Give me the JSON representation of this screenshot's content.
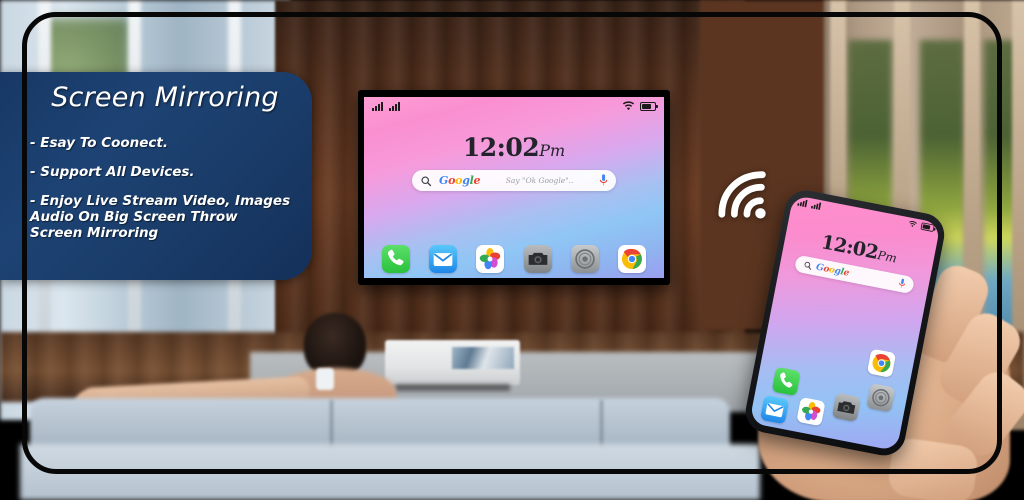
{
  "app": {
    "title": "Screen Mirroring",
    "promo_panel": {
      "heading": "Screen Mirroring",
      "features": [
        "- Esay To Coonect.",
        "- Support All Devices.",
        "- Enjoy Live Stream Video, Images\n Audio On Big Screen Throw\n Screen Mirroring"
      ]
    }
  },
  "colors": {
    "panel_blue_dark": "#14305a",
    "panel_blue_light": "#1d4374",
    "frame_black": "#070707",
    "screen_pink": "#ff8ecb",
    "screen_blue": "#93c2f4",
    "cast_white": "#ffffff"
  },
  "tv": {
    "label": "television",
    "screen": {
      "status_bar": {
        "signal_1": "signal-bars-full",
        "signal_2": "signal-bars-full",
        "wifi": "wifi-icon",
        "battery": "battery-icon",
        "battery_level": "78%"
      },
      "clock": {
        "time": "12:02",
        "meridiem": "Pm"
      },
      "search": {
        "logo": "Google",
        "logo_letters": [
          "G",
          "o",
          "o",
          "g",
          "l",
          "e"
        ],
        "placeholder": "Say \"Ok Google\"..",
        "search_icon": "search-icon",
        "mic_icon": "microphone-icon"
      },
      "dock_apps": [
        {
          "name": "Phone",
          "icon": "phone-icon"
        },
        {
          "name": "Mail",
          "icon": "mail-icon"
        },
        {
          "name": "Photos",
          "icon": "photos-icon"
        },
        {
          "name": "Camera",
          "icon": "camera-icon"
        },
        {
          "name": "Clock",
          "icon": "clock-icon"
        },
        {
          "name": "Chrome",
          "icon": "chrome-icon"
        }
      ]
    }
  },
  "phone": {
    "label": "smartphone-in-hand",
    "screen": {
      "status_bar": {
        "signal_1": "signal-bars-full",
        "signal_2": "signal-bars-full",
        "wifi": "wifi-icon",
        "battery": "battery-icon"
      },
      "clock": {
        "time": "12:02",
        "meridiem": "Pm"
      },
      "search": {
        "logo": "Google",
        "mic_icon": "microphone-icon",
        "search_icon": "search-icon"
      },
      "dock_apps": [
        {
          "name": "Phone",
          "icon": "phone-icon"
        },
        {
          "name": "Mail",
          "icon": "mail-icon"
        },
        {
          "name": "Photos",
          "icon": "photos-icon"
        },
        {
          "name": "Camera",
          "icon": "camera-icon"
        },
        {
          "name": "Clock",
          "icon": "clock-icon"
        },
        {
          "name": "Chrome",
          "icon": "chrome-icon"
        }
      ]
    }
  },
  "cast": {
    "icon": "wifi-cast-icon",
    "label": "wireless-mirroring-signal"
  },
  "scene": {
    "description": "living-room-background",
    "elements": [
      "wood-wall",
      "window-left",
      "window-right",
      "couch",
      "coffee-table",
      "person"
    ]
  }
}
